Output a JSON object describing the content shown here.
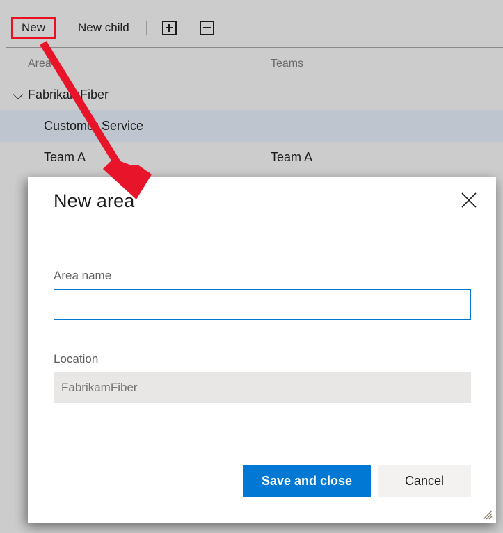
{
  "toolbar": {
    "new_label": "New",
    "new_child_label": "New child",
    "expand_all_icon": "plus-square-icon",
    "collapse_all_icon": "minus-square-icon"
  },
  "grid": {
    "columns": [
      "Area",
      "Teams"
    ],
    "rows": [
      {
        "area": "FabrikamFiber",
        "teams": "",
        "level": 0,
        "expanded": true,
        "selected": false
      },
      {
        "area": "Customer Service",
        "teams": "",
        "level": 1,
        "expanded": false,
        "selected": true
      },
      {
        "area": "Team A",
        "teams": "Team A",
        "level": 1,
        "expanded": false,
        "selected": false
      }
    ]
  },
  "dialog": {
    "title": "New area",
    "close_icon": "close-icon",
    "fields": {
      "area_name": {
        "label": "Area name",
        "value": "",
        "placeholder": ""
      },
      "location": {
        "label": "Location",
        "value": "",
        "placeholder": "FabrikamFiber"
      }
    },
    "buttons": {
      "save": "Save and close",
      "cancel": "Cancel"
    },
    "resize_grip_icon": "resize-grip-icon"
  },
  "annotation": {
    "highlight_target": "New",
    "arrow_color": "#e8142a",
    "highlight_color": "#e81123"
  },
  "colors": {
    "accent": "#0078d4",
    "backdrop": "#cccccc",
    "row_selected": "#bfc5cf",
    "dialog_bg": "#ffffff",
    "disabled_field_bg": "#e8e7e6",
    "cancel_bg": "#f3f2f1"
  }
}
